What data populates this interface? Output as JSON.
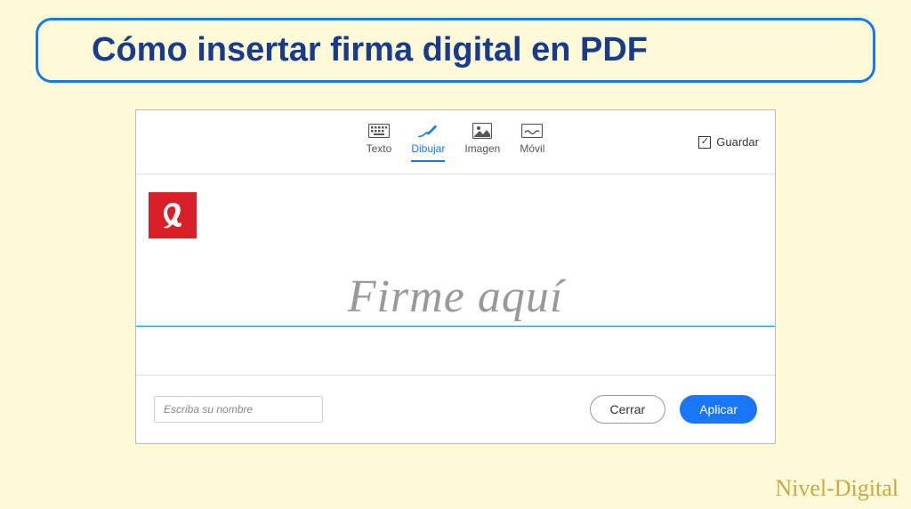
{
  "title": "Cómo insertar firma digital en PDF",
  "tabs": {
    "text": "Texto",
    "draw": "Dibujar",
    "image": "Imagen",
    "mobile": "Móvil"
  },
  "save": {
    "label": "Guardar",
    "checked": "✓"
  },
  "signature": {
    "placeholder": "Firme aquí"
  },
  "nameInput": {
    "placeholder": "Escriba su nombre"
  },
  "buttons": {
    "cancel": "Cerrar",
    "apply": "Aplicar"
  },
  "watermark": "Nivel-Digital"
}
